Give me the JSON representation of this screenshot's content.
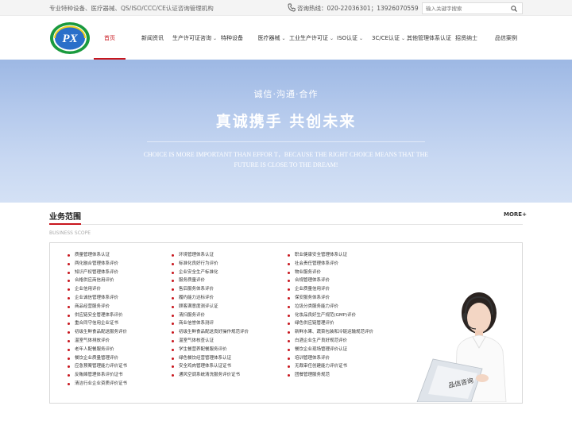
{
  "topbar": {
    "slogan": "专业特种设备、医疗器械、QS/ISO/CCC/CE认证咨询管理机构",
    "hotline": "咨询热线：020-22036301；13926070559",
    "search_placeholder": "输入关键字搜索"
  },
  "logo": {
    "text": "PX"
  },
  "nav": {
    "items": [
      {
        "label": "首页",
        "active": true,
        "caret": ""
      },
      {
        "label": "新闻资讯",
        "active": false,
        "caret": ""
      },
      {
        "label": "生产许可证咨询",
        "active": false,
        "caret": "⌄"
      },
      {
        "label": "特种设备",
        "active": false,
        "caret": ""
      },
      {
        "label": "医疗器械",
        "active": false,
        "caret": "⌄"
      },
      {
        "label": "工业生产许可证",
        "active": false,
        "caret": "⌄"
      },
      {
        "label": "ISO认证",
        "active": false,
        "caret": "⌄"
      },
      {
        "label": "3C/CE认证",
        "active": false,
        "caret": "⌄"
      },
      {
        "label": "其他管理体系认证",
        "active": false,
        "caret": ""
      },
      {
        "label": "招贤纳士",
        "active": false,
        "caret": ""
      },
      {
        "label": "品信案例",
        "active": false,
        "caret": ""
      }
    ]
  },
  "banner": {
    "subtitle": "诚信·沟通·合作",
    "title": "真诚携手  共创未来",
    "english": "CHOICE IS MORE IMPORTANT THAN EFFOR T，BECAUSE THE RIGHT CHOICE MEANS THAT THE FUTURE IS CLOSE TO THE DREAM!"
  },
  "scope": {
    "title": "业务范围",
    "subtitle": "BUSINESS SCOPE",
    "more": "MORE+",
    "columns": [
      [
        "质量管理体系认证",
        "两化融合管理体系评价",
        "知识产权管理体系评价",
        "合格供应商信用评价",
        "企业信用评价",
        "企业诚信管理体系评价",
        "商品经营服务评价",
        "供应链安全管理体系评价",
        "重合同守信用企业证书",
        "初级生鲜食品配送服务评价",
        "温室气体排放评价",
        "老年人配餐服务评价",
        "餐饮企业质量管理评价",
        "应急预案管理能力评价证书",
        "反贿赂管理体系评价证书",
        "清洁行业企业资质评价证书"
      ],
      [
        "环境管理体系认证",
        "标准化良好行为评价",
        "企业安全生产标准化",
        "服务质量评价",
        "售后服务体系评价",
        "履约能力达标评价",
        "顾客满意度测评认证",
        "清扫服务评价",
        "商业信誉体系测评",
        "初级生鲜食品配送良好操作规范评价",
        "温室气体核查认证",
        "学生餐营养配餐服务评价",
        "绿色餐饮经营管理体系认证",
        "安全鸡肉管理体系认证证书",
        "通风空调系统清洗服务评价证书"
      ],
      [
        "职业健康安全管理体系认证",
        "社会责任管理体系评价",
        "物业服务评价",
        "合规管理体系评价",
        "企业质量信用评价",
        "保安服务体系评价",
        "垃圾分类服务能力评价",
        "化妆品良好生产规范(GMP)评价",
        "绿色供应链管理评价",
        "新鲜水果、蔬菜包装和冷链运输规范评价",
        "白酒企业生产良好规范评价",
        "餐饮企业现场管理评价认证",
        "培训管理体系评价",
        "无裁审任创建能力评价证书",
        "团餐管理服务规范"
      ]
    ],
    "illustration_label": "品信咨询"
  }
}
